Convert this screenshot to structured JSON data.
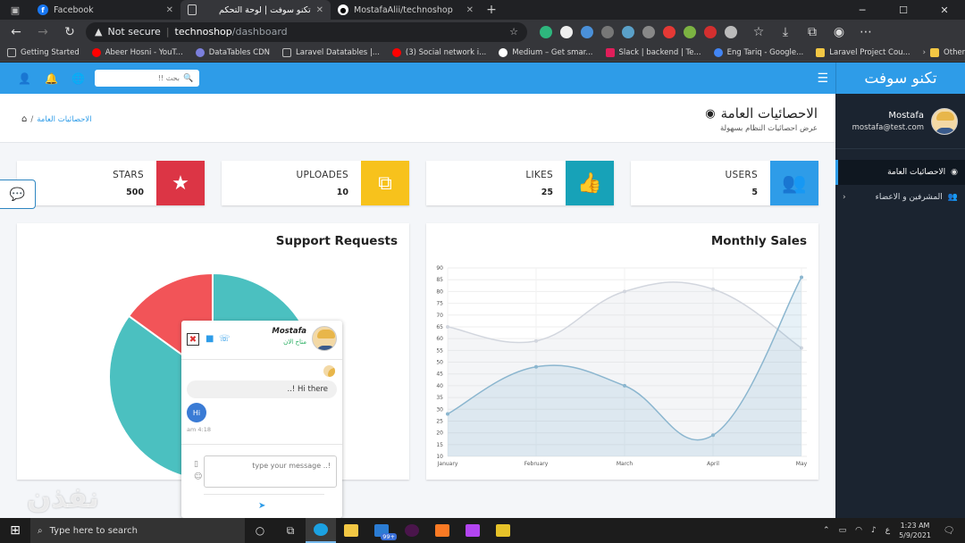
{
  "browser": {
    "tabs": [
      {
        "title": "Facebook",
        "favicon": "facebook-icon",
        "active": false
      },
      {
        "title": "تكنو سوفت | لوحة التحكم",
        "favicon": "document-icon",
        "active": true
      },
      {
        "title": "MostafaAlii/technoshop",
        "favicon": "github-icon",
        "active": false
      }
    ],
    "address": {
      "security_label": "Not secure",
      "host": "technoshop",
      "path": "/dashboard"
    },
    "bookmarks": [
      {
        "label": "Getting Started",
        "icon_color": "#bbbbbb"
      },
      {
        "label": "Abeer Hosni - YouT...",
        "icon_color": "#ff0000"
      },
      {
        "label": "DataTables CDN",
        "icon_color": "#7b7fdc"
      },
      {
        "label": "Laravel Datatables |...",
        "icon_color": "#bbbbbb"
      },
      {
        "label": "(3) Social network i...",
        "icon_color": "#ff0000"
      },
      {
        "label": "Medium – Get smar...",
        "icon_color": "#ffffff"
      },
      {
        "label": "Slack | backend | Te...",
        "icon_color": "#e01e5a"
      },
      {
        "label": "Eng Tariq - Google...",
        "icon_color": "#4285f4"
      },
      {
        "label": "Laravel Project Cou...",
        "icon_color": "#f2c744"
      }
    ],
    "other_favorites": "Other favorites"
  },
  "app": {
    "brand": "تكنو سوفت",
    "search_placeholder": "بحث !!",
    "user": {
      "name": "Mostafa",
      "email": "mostafa@test.com"
    },
    "sidebar": [
      {
        "label": "الاحصائيات العامة",
        "icon": "dashboard-icon",
        "active": true
      },
      {
        "label": "المشرفين و الاعضاء",
        "icon": "users-icon",
        "active": false
      }
    ],
    "page_title": "الاحصائيات العامة",
    "page_subtitle": "عرض احصائيات النظام بسهولة",
    "breadcrumb": {
      "current": "الاحصائيات العامة",
      "separator": "/"
    }
  },
  "stats": [
    {
      "label": "STARS",
      "value": "500",
      "color": "#dc3545",
      "icon": "star-icon"
    },
    {
      "label": "UPLOADES",
      "value": "10",
      "color": "#f7c21c",
      "icon": "copy-icon"
    },
    {
      "label": "LIKES",
      "value": "25",
      "color": "#17a2b8",
      "icon": "thumbs-up-icon"
    },
    {
      "label": "USERS",
      "value": "5",
      "color": "#2e9ce8",
      "icon": "users-icon"
    }
  ],
  "panels": {
    "support_title": "Support Requests",
    "sales_title": "Monthly Sales"
  },
  "chart_data": [
    {
      "type": "line",
      "title": "Monthly Sales",
      "categories": [
        "January",
        "February",
        "March",
        "April",
        "May"
      ],
      "ylim": [
        10,
        90
      ],
      "yticks": [
        10,
        15,
        20,
        25,
        30,
        35,
        40,
        45,
        50,
        55,
        60,
        65,
        70,
        75,
        80,
        85,
        90
      ],
      "grid": true,
      "series": [
        {
          "values": [
            65,
            59,
            80,
            81,
            56
          ],
          "color": "#d2d6de",
          "fill": "rgba(210,214,222,0.25)"
        },
        {
          "values": [
            28,
            48,
            40,
            19,
            86
          ],
          "color": "#8bb6cf",
          "fill": "rgba(60,141,188,0.12)"
        }
      ]
    },
    {
      "type": "pie",
      "title": "Support Requests",
      "values": [
        35,
        50,
        15
      ],
      "colors": [
        "#4bc0c0",
        "#4bc0c0",
        "#f25458"
      ],
      "slice_colors_note_free": true
    }
  ],
  "chat": {
    "name": "Mostafa",
    "status": "متاح الان",
    "messages": [
      {
        "from": "them",
        "text": "Hi there !.."
      },
      {
        "from": "me",
        "text": "Hi",
        "time": "4:18 am"
      }
    ],
    "input_placeholder": "type your message ..!"
  },
  "taskbar": {
    "search_placeholder": "Type here to search",
    "badge": "99+",
    "lang": "ع",
    "time": "1:23 AM",
    "date": "5/9/2021"
  },
  "watermark": "نفذن"
}
